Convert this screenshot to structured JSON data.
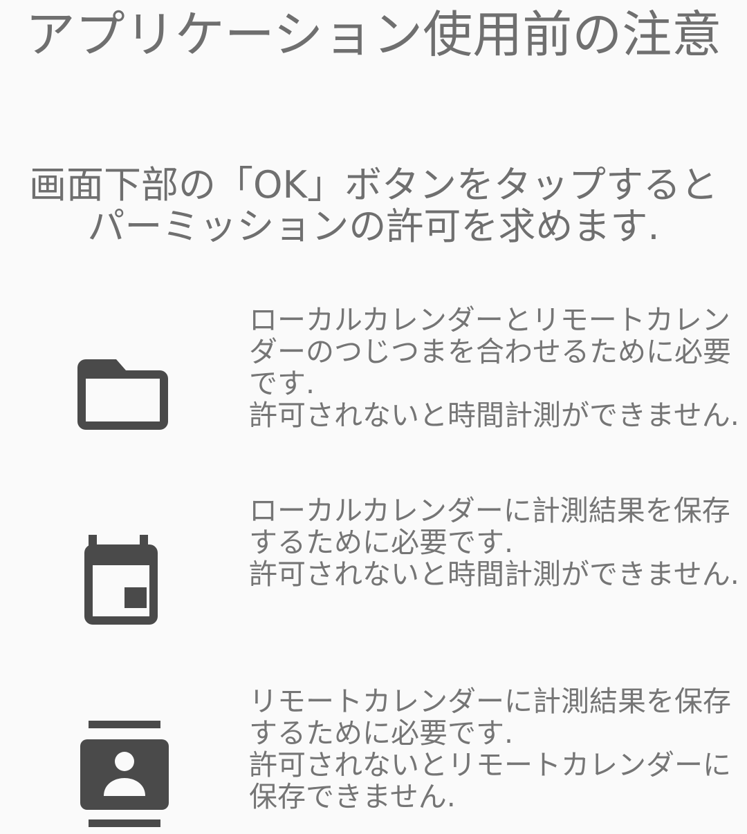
{
  "title": "アプリケーション使用前の注意",
  "intro": {
    "line1": "画面下部の「OK」ボタンをタップすると",
    "line2": "パーミッションの許可を求めます."
  },
  "permissions": [
    {
      "icon": "folder-icon",
      "description": "ローカルカレンダーとリモートカレンダーのつじつまを合わせるために必要です.",
      "consequence": "許可されないと時間計測ができません."
    },
    {
      "icon": "calendar-icon",
      "description": "ローカルカレンダーに計測結果を保存するために必要です.",
      "consequence": "許可されないと時間計測ができません."
    },
    {
      "icon": "contacts-icon",
      "description": "リモートカレンダーに計測結果を保存するために必要です.",
      "consequence": "許可されないとリモートカレンダーに保存できません."
    }
  ],
  "colors": {
    "background": "#fafafa",
    "text": "#757575",
    "icon": "#4a4a4a"
  }
}
